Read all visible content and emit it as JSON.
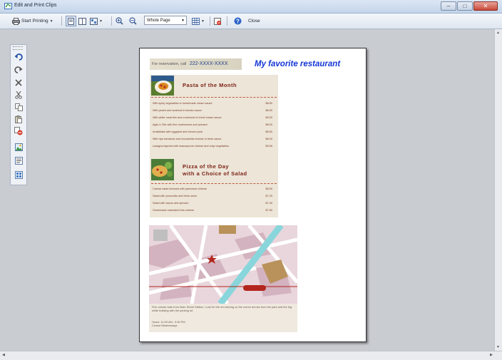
{
  "window": {
    "title": "Edit and Print Clips"
  },
  "toolbar": {
    "start_printing": "Start Printing",
    "zoom_value": "Whole Page",
    "close": "Close"
  },
  "clip": {
    "reservation_text": "For reservation, call",
    "phone": "222-XXXX-XXXX",
    "headline": "My favorite restaurant",
    "section1_title": "Pasta of the Month",
    "section1_rows": [
      {
        "name": "With spicy vegetables in homemade cream sauce",
        "price": "$8.50"
      },
      {
        "name": "With peach and seafood in tomato sauce",
        "price": "$8.50"
      },
      {
        "name": "With white meat fish and mushroom in fresh cream sauce",
        "price": "$9.00"
      },
      {
        "name": "Aglio e Olio with fine mushrooms and spinach",
        "price": "$8.00"
      },
      {
        "name": "Arrabbiata with eggplant and minced pork",
        "price": "$8.50"
      },
      {
        "name": "With ripe tomatoes and mozzarella cheese in fresh sauce",
        "price": "$8.00"
      },
      {
        "name": "Lasagna layered with mascarpone cheese and crisp vegetables",
        "price": "$9.50"
      }
    ],
    "section2_title_line1": "Pizza of the Day",
    "section2_title_line2": "with a Choice of Salad",
    "section2_rows": [
      {
        "name": "Caesar salad dressed with parmesan cheese",
        "price": "$8.50"
      },
      {
        "name": "Salad with prosciutto and fresh onion",
        "price": "$7.20"
      },
      {
        "name": "Salad with bacon and spinach",
        "price": "$7.40"
      },
      {
        "name": "Homemade marinated tofu cheese",
        "price": "$7.60"
      }
    ],
    "map_note": "Five-minute walk from Main Street Station. Look for the red awning on the corner across from the park and the big white building with the parking lot.",
    "hours_line1": "Hours: 11:00 AM - 9:30 PM",
    "hours_line2": "Closed Wednesdays"
  },
  "icons": {
    "toolbar": [
      "printer-icon",
      "page-view-icon",
      "two-page-view-icon",
      "layout-icon",
      "zoom-in-icon",
      "zoom-out-icon",
      "grid-icon",
      "delete-clip-icon",
      "help-icon"
    ],
    "side": [
      "undo-icon",
      "redo-icon",
      "delete-icon",
      "cut-icon",
      "copy-icon",
      "paste-icon",
      "delete-all-icon",
      "add-image-icon",
      "add-text-icon",
      "arrange-icon"
    ]
  },
  "colors": {
    "accent": "#1437d6",
    "menu_title": "#7a1e12",
    "clip_bg": "#ece5d8"
  }
}
